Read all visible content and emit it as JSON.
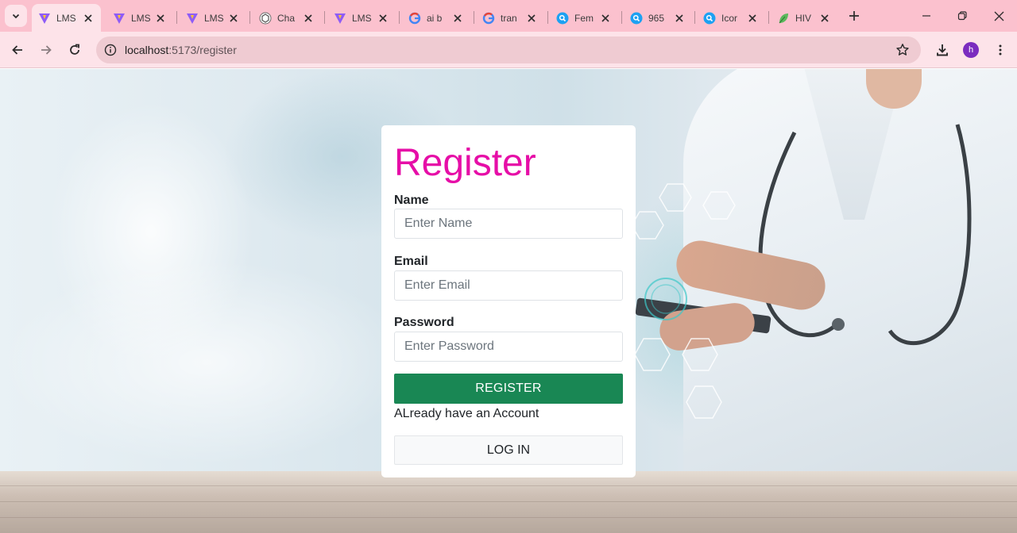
{
  "browser": {
    "tabs": [
      {
        "title": "LMS",
        "favicon": "vite-icon",
        "active": true
      },
      {
        "title": "LMS",
        "favicon": "vite-icon",
        "active": false
      },
      {
        "title": "LMS",
        "favicon": "vite-icon",
        "active": false
      },
      {
        "title": "Cha",
        "favicon": "chatgpt-icon",
        "active": false
      },
      {
        "title": "LMS",
        "favicon": "vite-icon",
        "active": false
      },
      {
        "title": "ai b",
        "favicon": "google-icon",
        "active": false
      },
      {
        "title": "tran",
        "favicon": "google-icon",
        "active": false
      },
      {
        "title": "Fem",
        "favicon": "search-bubble-icon",
        "active": false
      },
      {
        "title": "965",
        "favicon": "search-bubble-icon",
        "active": false
      },
      {
        "title": "Icor",
        "favicon": "search-bubble-icon",
        "active": false
      },
      {
        "title": "HIV",
        "favicon": "leaf-icon",
        "active": false
      }
    ],
    "url": {
      "host": "localhost",
      "path": ":5173/register"
    },
    "profile_initial": "h",
    "colors": {
      "tabstrip": "#fbc1ce",
      "toolbar": "#fde3e9",
      "avatar": "#7b2cbf"
    }
  },
  "register": {
    "title": "Register",
    "name_label": "Name",
    "name_placeholder": "Enter Name",
    "email_label": "Email",
    "email_placeholder": "Enter Email",
    "password_label": "Password",
    "password_placeholder": "Enter Password",
    "register_button": "REGISTER",
    "already_text": "ALready have an Account",
    "login_button": "LOG IN",
    "colors": {
      "title": "#e60ea7",
      "register_button": "#198754"
    }
  }
}
